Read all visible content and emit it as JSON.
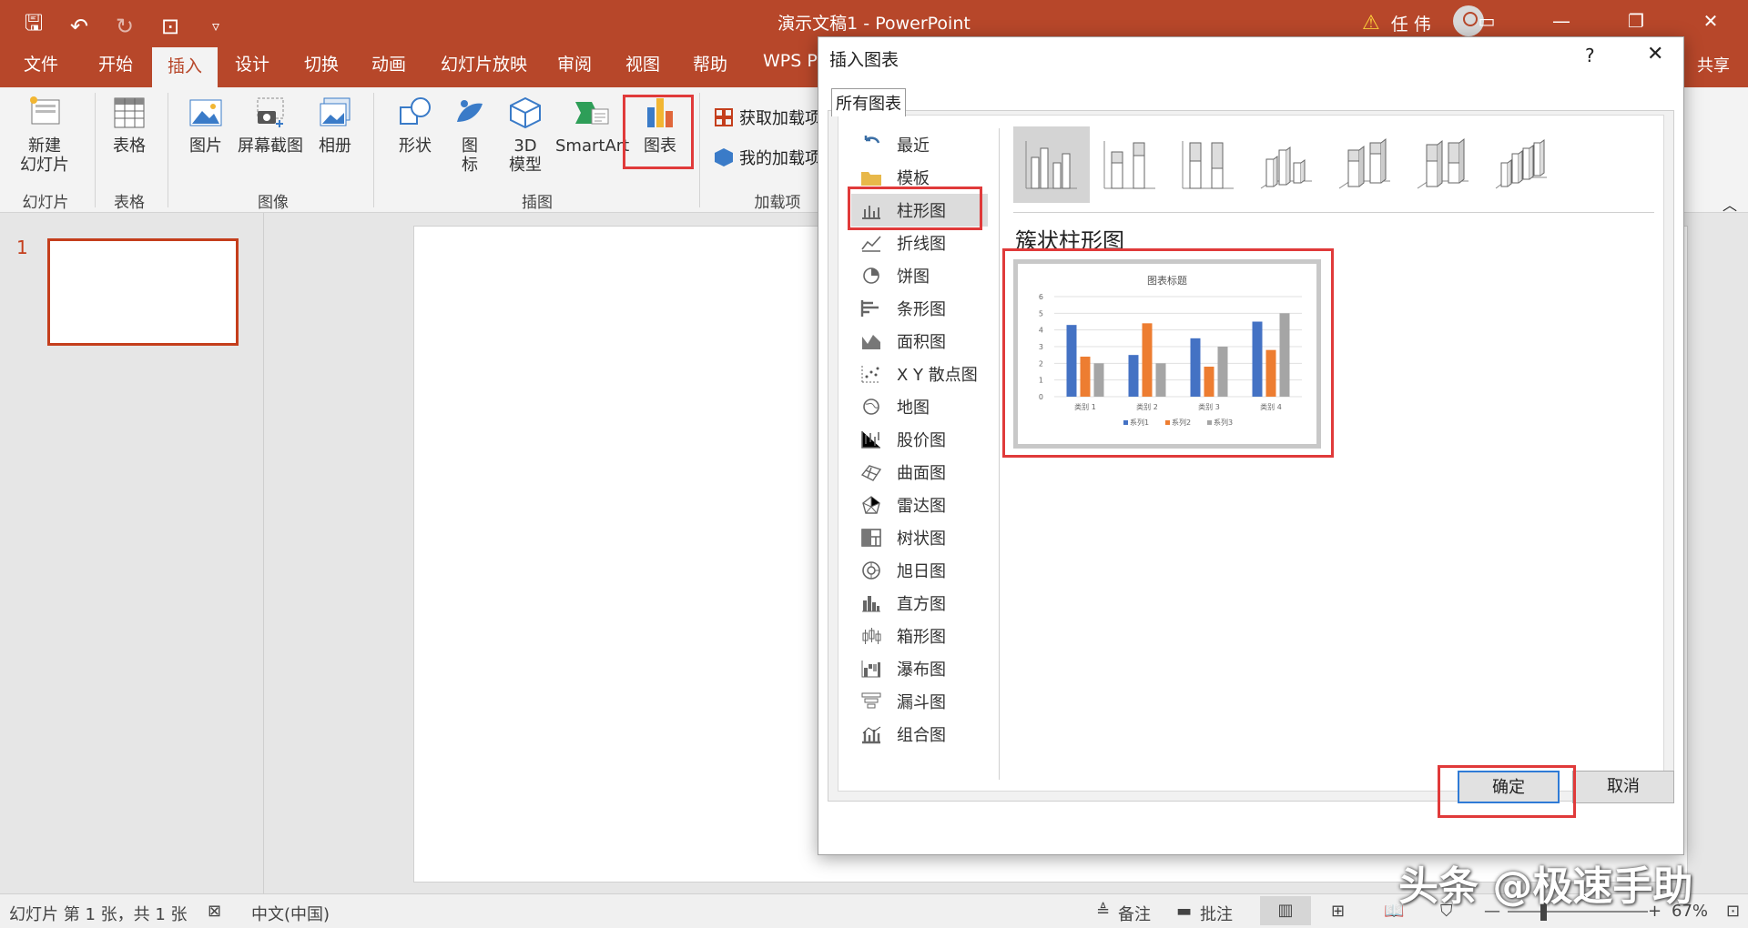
{
  "app": {
    "window_title": "演示文稿1  -  PowerPoint",
    "user_name": "任 伟"
  },
  "ribbon_tabs": [
    "文件",
    "开始",
    "插入",
    "设计",
    "切换",
    "动画",
    "幻灯片放映",
    "审阅",
    "视图",
    "帮助",
    "WPS PD"
  ],
  "active_tab": "插入",
  "share_label": "共享",
  "ribbon": {
    "new_slide": "新建\n幻灯片",
    "table": "表格",
    "picture": "图片",
    "screenshot": "屏幕截图",
    "album": "相册",
    "shapes": "形状",
    "icons": "图\n标",
    "model3d": "3D\n模型",
    "smartart": "SmartArt",
    "chart": "图表",
    "get_addins": "获取加载项",
    "my_addins": "我的加载项",
    "groups": {
      "slides": "幻灯片",
      "tables": "表格",
      "images": "图像",
      "illustrations": "插图",
      "addins": "加载项"
    }
  },
  "thumbnails": {
    "slide_number": "1"
  },
  "status": {
    "slide_info": "幻灯片 第 1 张，共 1 张",
    "language": "中文(中国)",
    "notes": "备注",
    "comments": "批注",
    "zoom": "67%"
  },
  "dialog": {
    "title": "插入图表",
    "help": "?",
    "close": "✕",
    "tab": "所有图表",
    "categories": [
      "最近",
      "模板",
      "柱形图",
      "折线图",
      "饼图",
      "条形图",
      "面积图",
      "X Y 散点图",
      "地图",
      "股价图",
      "曲面图",
      "雷达图",
      "树状图",
      "旭日图",
      "直方图",
      "箱形图",
      "瀑布图",
      "漏斗图",
      "组合图"
    ],
    "selected_category": "柱形图",
    "subtype_name": "簇状柱形图",
    "ok": "确定",
    "cancel": "取消"
  },
  "chart_data": {
    "type": "bar",
    "title": "图表标题",
    "categories": [
      "类别 1",
      "类别 2",
      "类别 3",
      "类别 4"
    ],
    "series": [
      {
        "name": "系列1",
        "values": [
          4.3,
          2.5,
          3.5,
          4.5
        ],
        "color": "#4472c4"
      },
      {
        "name": "系列2",
        "values": [
          2.4,
          4.4,
          1.8,
          2.8
        ],
        "color": "#ed7d31"
      },
      {
        "name": "系列3",
        "values": [
          2,
          2,
          3,
          5
        ],
        "color": "#a5a5a5"
      }
    ],
    "yticks": [
      "0",
      "1",
      "2",
      "3",
      "4",
      "5",
      "6"
    ],
    "ylim": [
      0,
      6
    ],
    "grid": true,
    "legend": "bottom"
  },
  "watermark": "头条 @极速手助",
  "colors": {
    "accent": "#b7472a",
    "highlight": "#e03a3a"
  }
}
